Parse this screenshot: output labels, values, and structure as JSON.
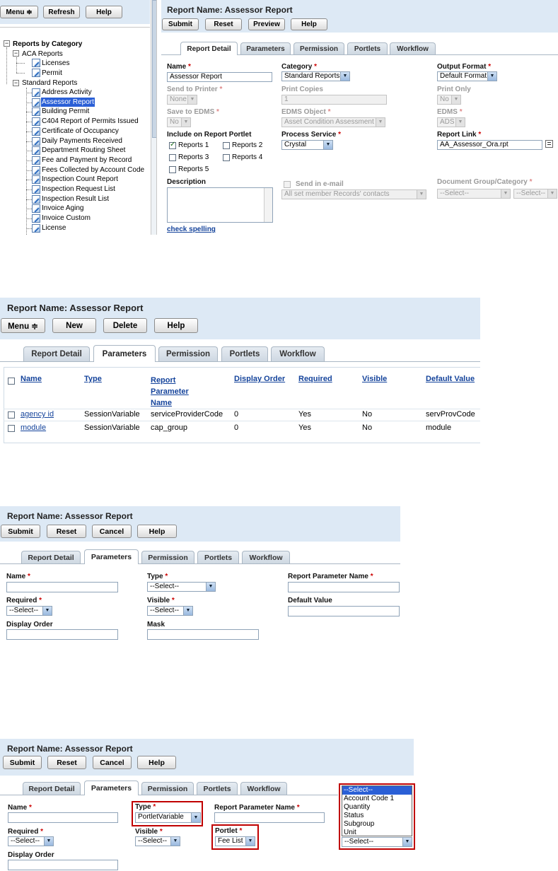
{
  "p1": {
    "left": {
      "menu": "Menu ≑",
      "refresh": "Refresh",
      "help": "Help",
      "tree_root": "Reports by Category",
      "group1": "ACA Reports",
      "group1_items": [
        "Licenses",
        "Permit"
      ],
      "group2": "Standard Reports",
      "group2_items": [
        "Address Activity",
        "Assessor Report",
        "Building Permit",
        "C404 Report of Permits Issued",
        "Certificate of Occupancy",
        "Daily Payments Received",
        "Department Routing Sheet",
        "Fee and Payment by Record",
        "Fees Collected by Account Code",
        "Inspection Count Report",
        "Inspection Request List",
        "Inspection Result List",
        "Invoice Aging",
        "Invoice Custom",
        "License"
      ]
    },
    "title": "Report Name: Assessor Report",
    "buttons": [
      "Submit",
      "Reset",
      "Preview",
      "Help"
    ],
    "tabs": [
      "Report Detail",
      "Parameters",
      "Permission",
      "Portlets",
      "Workflow"
    ],
    "form": {
      "name_label": "Name",
      "name_value": "Assessor Report",
      "category_label": "Category",
      "category_value": "Standard Reports",
      "output_label": "Output Format",
      "output_value": "Default Format",
      "printer_label": "Send to Printer",
      "printer_value": "None",
      "copies_label": "Print Copies",
      "copies_value": "1",
      "printonly_label": "Print Only",
      "printonly_value": "No",
      "edms_label": "Save to EDMS",
      "edms_value": "No",
      "edmsobj_label": "EDMS Object",
      "edmsobj_value": "Asset Condition Assessment",
      "edms2_label": "EDMS",
      "edms2_value": "ADS",
      "portlet_label": "Include on Report Portlet",
      "portlets": [
        "Reports 1",
        "Reports 2",
        "Reports 3",
        "Reports 4",
        "Reports 5"
      ],
      "process_label": "Process Service",
      "process_value": "Crystal",
      "link_label": "Report Link",
      "link_value": "AA_Assessor_Ora.rpt",
      "desc_label": "Description",
      "spell": "check spelling",
      "email_label": "Send in e-mail",
      "email_value": "All set member Records' contacts",
      "docgroup_label": "Document Group/Category",
      "docgroup_value1": "--Select--",
      "docgroup_value2": "--Select--"
    }
  },
  "p2": {
    "title": "Report Name: Assessor Report",
    "buttons": [
      "Menu ≑",
      "New",
      "Delete",
      "Help"
    ],
    "tabs": [
      "Report Detail",
      "Parameters",
      "Permission",
      "Portlets",
      "Workflow"
    ],
    "columns": [
      "Name",
      "Type",
      "Report Parameter Name",
      "Display Order",
      "Required",
      "Visible",
      "Default Value"
    ],
    "col_report": [
      "Report",
      "Parameter",
      "Name"
    ],
    "rows": [
      [
        "agency id",
        "SessionVariable",
        "serviceProviderCode",
        "0",
        "Yes",
        "No",
        "servProvCode"
      ],
      [
        "module",
        "SessionVariable",
        "cap_group",
        "0",
        "Yes",
        "No",
        "module"
      ]
    ]
  },
  "p3": {
    "title": "Report Name: Assessor Report",
    "buttons": [
      "Submit",
      "Reset",
      "Cancel",
      "Help"
    ],
    "tabs": [
      "Report Detail",
      "Parameters",
      "Permission",
      "Portlets",
      "Workflow"
    ],
    "name_label": "Name",
    "type_label": "Type",
    "type_value": "--Select--",
    "rpn_label": "Report Parameter Name",
    "required_label": "Required",
    "required_value": "--Select--",
    "visible_label": "Visible",
    "visible_value": "--Select--",
    "default_label": "Default Value",
    "order_label": "Display Order",
    "mask_label": "Mask"
  },
  "p4": {
    "title": "Report Name: Assessor Report",
    "buttons": [
      "Submit",
      "Reset",
      "Cancel",
      "Help"
    ],
    "tabs": [
      "Report Detail",
      "Parameters",
      "Permission",
      "Portlets",
      "Workflow"
    ],
    "name_label": "Name",
    "type_label": "Type",
    "type_value": "PortletVariable",
    "rpn_label": "Report Parameter Name",
    "required_label": "Required",
    "required_value": "--Select--",
    "visible_label": "Visible",
    "visible_value": "--Select--",
    "portlet_label": "Portlet",
    "portlet_value": "Fee List",
    "order_label": "Display Order",
    "dropdown_options": [
      "--Select--",
      "Account Code 1",
      "Quantity",
      "Status",
      "Subgroup",
      "Unit"
    ],
    "dropdown_value": "--Select--"
  },
  "required_mark": "*",
  "arrow": "▼",
  "colors": {
    "header": "#dde9f5",
    "link": "#14439b",
    "highlight": "#c00000",
    "selected": "#2a5fd6"
  }
}
